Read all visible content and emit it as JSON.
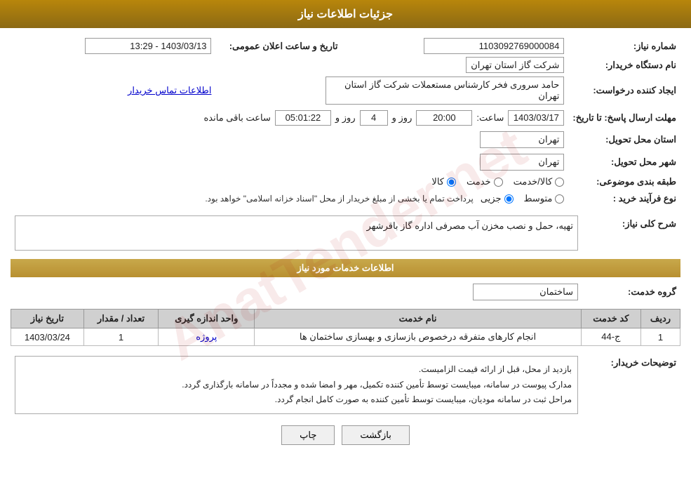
{
  "header": {
    "title": "جزئیات اطلاعات نیاز"
  },
  "fields": {
    "need_number_label": "شماره نیاز:",
    "need_number_value": "1103092769000084",
    "announcement_date_label": "تاریخ و ساعت اعلان عمومی:",
    "announcement_date_value": "1403/03/13 - 13:29",
    "buyer_name_label": "نام دستگاه خریدار:",
    "buyer_name_value": "شرکت گاز استان تهران",
    "creator_label": "ایجاد کننده درخواست:",
    "creator_value": "حامد سروری فخر کارشناس مستعملات شرکت گاز استان تهران",
    "contact_link": "اطلاعات تماس خریدار",
    "send_date_label": "مهلت ارسال پاسخ: تا تاریخ:",
    "send_date_value": "1403/03/17",
    "send_time_label": "ساعت:",
    "send_time_value": "20:00",
    "send_days_label": "روز و",
    "send_days_value": "4",
    "remaining_label": "ساعت باقی مانده",
    "remaining_value": "05:01:22",
    "delivery_province_label": "استان محل تحویل:",
    "delivery_province_value": "تهران",
    "delivery_city_label": "شهر محل تحویل:",
    "delivery_city_value": "تهران",
    "category_label": "طبقه بندی موضوعی:",
    "category_options": [
      "کالا",
      "خدمت",
      "کالا/خدمت"
    ],
    "category_selected": "کالا",
    "procurement_label": "نوع فرآیند خرید :",
    "procurement_options": [
      "جزیی",
      "متوسط"
    ],
    "procurement_text": "پرداخت تمام یا بخشی از مبلغ خریدار از محل \"اسناد خزانه اسلامی\" خواهد بود.",
    "need_desc_label": "شرح کلی نیاز:",
    "need_desc_value": "تهیه، حمل و نصب مخزن آب مصرفی اداره گاز باقرشهر",
    "services_info_label": "اطلاعات خدمات مورد نیاز",
    "service_group_label": "گروه خدمت:",
    "service_group_value": "ساختمان",
    "table": {
      "columns": [
        "ردیف",
        "کد خدمت",
        "نام خدمت",
        "واحد اندازه گیری",
        "تعداد / مقدار",
        "تاریخ نیاز"
      ],
      "rows": [
        {
          "row": "1",
          "code": "ج-44",
          "name": "انجام کارهای متفرقه درخصوص بازسازی و بهسازی ساختمان ها",
          "unit": "پروژه",
          "quantity": "1",
          "date": "1403/03/24"
        }
      ]
    },
    "buyer_notes_label": "توضیحات خریدار:",
    "buyer_notes_lines": [
      "بازدید از محل، قبل از ارائه قیمت الزامیست.",
      "مدارک پیوست در سامانه، میبایست توسط تأمین کننده تکمیل، مهر و امضا شده و مجدداً در سامانه بارگذاری گردد.",
      "مراحل ثبت در سامانه مودیان، میبایست توسط تأمین کننده به صورت کامل انجام گردد."
    ],
    "btn_print": "چاپ",
    "btn_back": "بازگشت"
  },
  "watermark": "AnatTender.net"
}
